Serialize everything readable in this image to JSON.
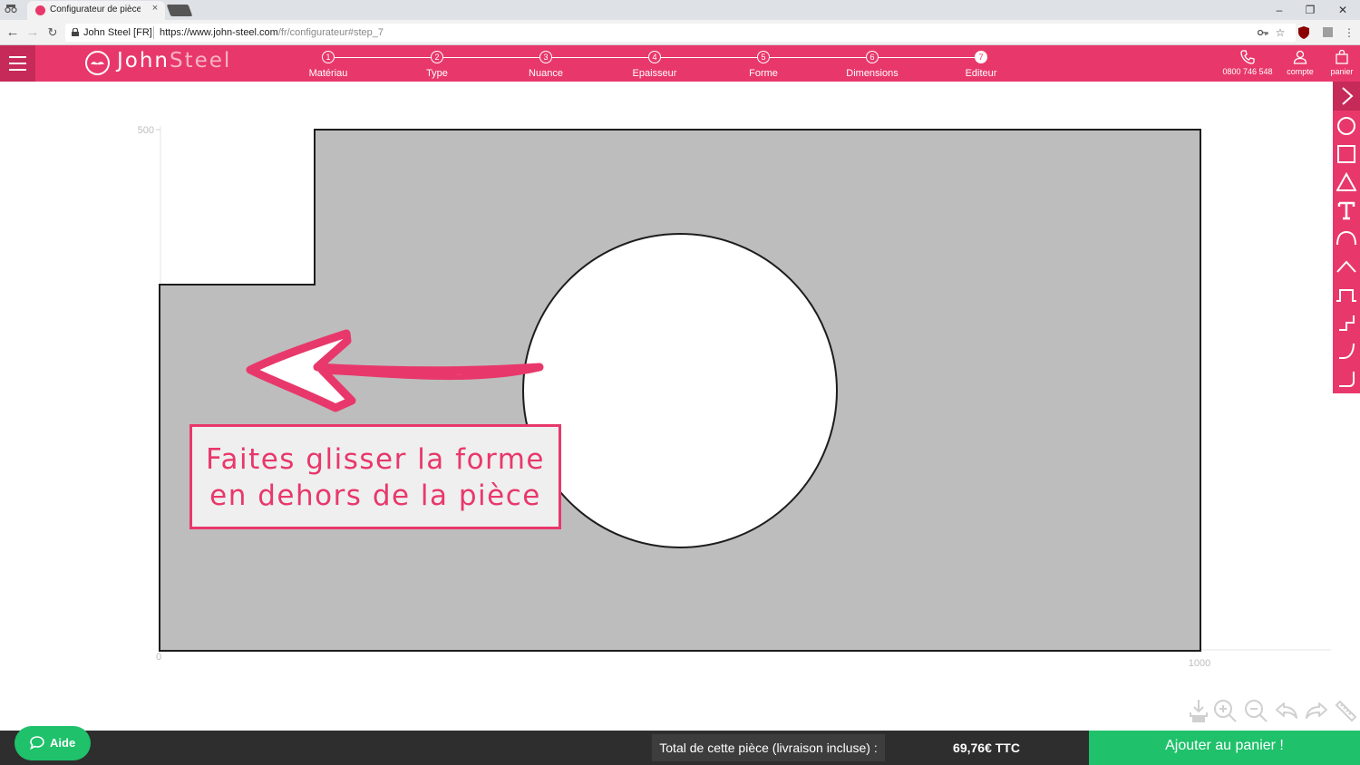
{
  "browser": {
    "tab_title": "Configurateur de pièces",
    "tab_close": "×",
    "site_name": "John Steel [FR]",
    "url_host": "https://www.john-steel.com",
    "url_path": "/fr/configurateur#step_7",
    "window_controls": {
      "minimize": "–",
      "restore": "❐",
      "close": "✕"
    }
  },
  "header": {
    "logo_text_part1": "John",
    "logo_text_part2": "Steel",
    "steps": [
      {
        "number": "1",
        "label": "Matériau"
      },
      {
        "number": "2",
        "label": "Type"
      },
      {
        "number": "3",
        "label": "Nuance"
      },
      {
        "number": "4",
        "label": "Epaisseur"
      },
      {
        "number": "5",
        "label": "Forme"
      },
      {
        "number": "6",
        "label": "Dimensions"
      },
      {
        "number": "7",
        "label": "Editeur"
      }
    ],
    "active_step": 7,
    "phone": "0800 746 548",
    "account_label": "compte",
    "cart_label": "panier"
  },
  "editor": {
    "axis": {
      "y_max_label": "500",
      "x_min_label": "0",
      "x_max_label": "1000"
    },
    "piece_fill": "#bdbdbd",
    "hole_fill": "#ffffff"
  },
  "toolbar": {
    "tools": [
      "expand-icon",
      "circle-icon",
      "square-icon",
      "triangle-icon",
      "text-icon",
      "arc-icon",
      "chamfer-peak-icon",
      "notch-icon",
      "step-icon",
      "rounded-corner-icon",
      "corner-icon"
    ]
  },
  "hint": {
    "line1": "Faites glisser la forme",
    "line2": "en dehors de la pièce"
  },
  "footer": {
    "help_label": "Aide",
    "total_label": "Total de cette pièce (livraison incluse) :",
    "total_price": "69,76€ TTC",
    "add_to_cart": "Ajouter au panier !"
  },
  "colors": {
    "brand": "#e8386b",
    "brand_dark": "#c62a58",
    "success": "#1fc16b",
    "footer": "#2e2e2e"
  }
}
